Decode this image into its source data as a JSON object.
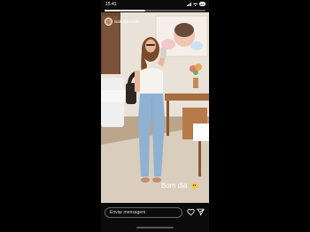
{
  "status": {
    "time": "15:41",
    "battery": "48"
  },
  "story": {
    "username": "isabellabrasile",
    "progress": 0.4,
    "caption": "Bom dia",
    "emoji_icon": "smile-emoji"
  },
  "reply": {
    "placeholder": "Enviar mensagem"
  },
  "colors": {
    "background": "#000000",
    "wall": "#e9e3da",
    "floor": "#bfa98e",
    "accent": "#ffffff"
  }
}
